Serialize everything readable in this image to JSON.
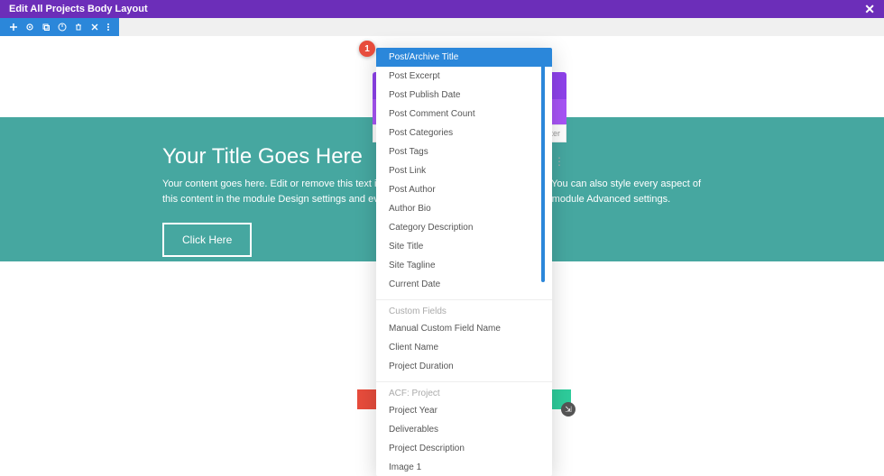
{
  "topbar": {
    "title": "Edit All Projects Body Layout",
    "close": "✕"
  },
  "hero": {
    "title": "Your Title Goes Here",
    "text": "Your content goes here. Edit or remove this text inline or in the module Content settings. You can also style every aspect of this content in the module Design settings and even apply custom CSS to this text in the module Advanced settings.",
    "button": "Click Here"
  },
  "filter": {
    "placeholder": "ter"
  },
  "callout": {
    "num": "1"
  },
  "dropdown": {
    "main": [
      "Post/Archive Title",
      "Post Excerpt",
      "Post Publish Date",
      "Post Comment Count",
      "Post Categories",
      "Post Tags",
      "Post Link",
      "Post Author",
      "Author Bio",
      "Category Description",
      "Site Title",
      "Site Tagline",
      "Current Date"
    ],
    "section1_label": "Custom Fields",
    "section1": [
      "Manual Custom Field Name",
      "Client Name",
      "Project Duration"
    ],
    "section2_label": "ACF: Project",
    "section2": [
      "Project Year",
      "Deliverables",
      "Project Description",
      "Image 1"
    ]
  }
}
